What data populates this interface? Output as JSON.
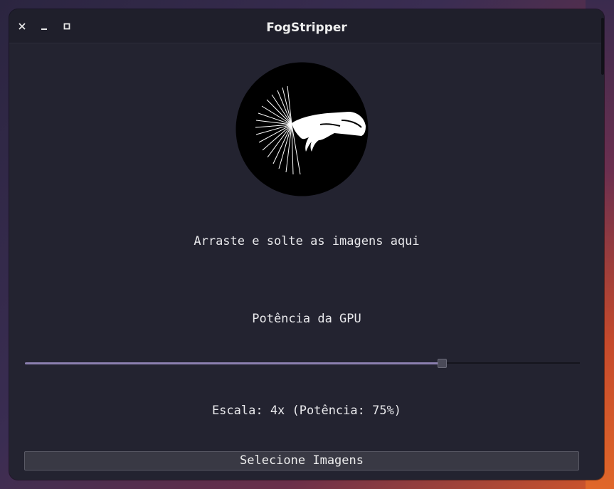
{
  "window": {
    "title": "FogStripper",
    "controls": [
      "close-icon",
      "minimize-icon",
      "maximize-icon"
    ]
  },
  "logo": {
    "icon": "hand-light-rays-icon"
  },
  "drop_zone": {
    "label": "Arraste e solte as imagens aqui"
  },
  "gpu": {
    "label": "Potência da GPU",
    "slider_percent": 75,
    "status": "Escala: 4x (Potência: 75%)"
  },
  "actions": {
    "select_images_label": "Selecione Imagens"
  },
  "colors": {
    "window_bg": "#232330",
    "titlebar_bg": "#1f1f2b",
    "accent": "#8c80b0",
    "text": "#e9e9ec"
  }
}
